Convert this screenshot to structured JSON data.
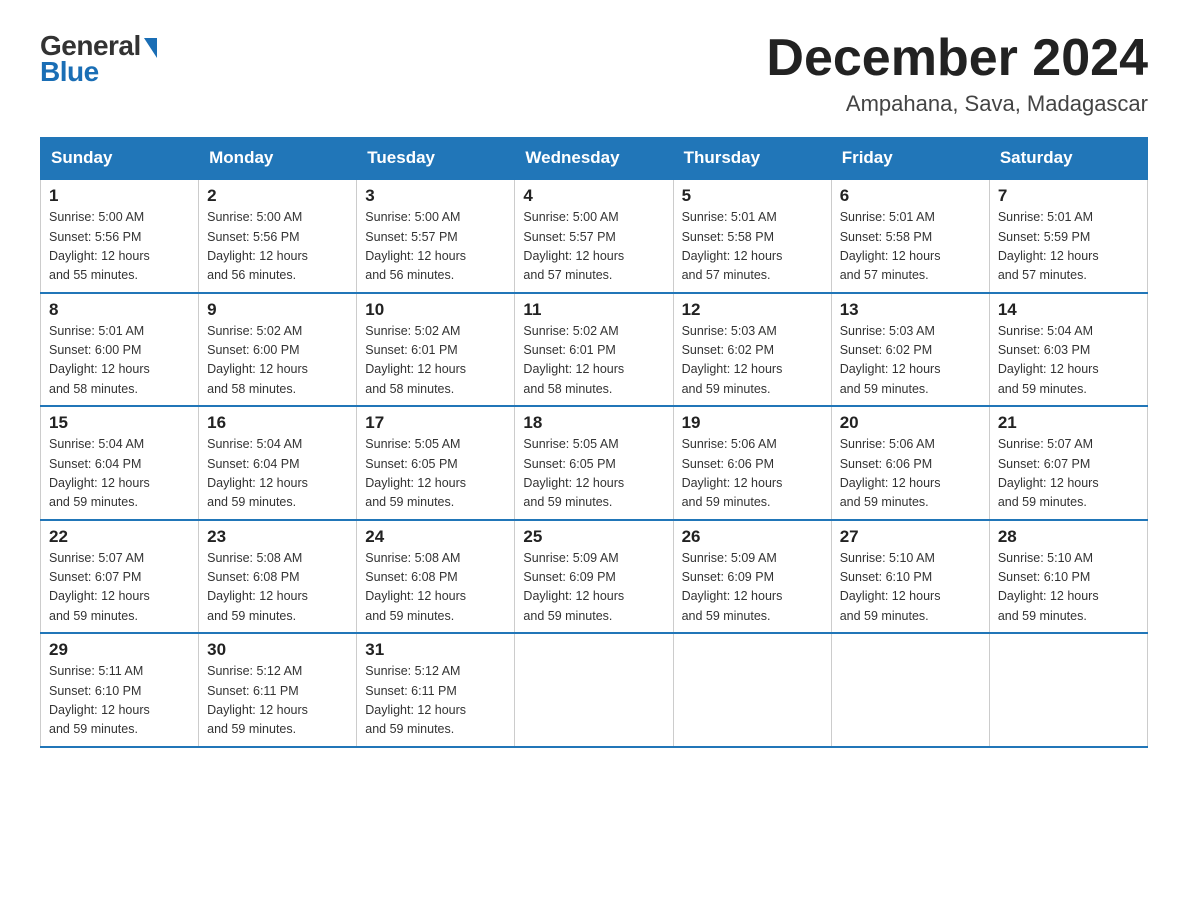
{
  "logo": {
    "general": "General",
    "blue": "Blue",
    "triangle": "▶"
  },
  "header": {
    "month_year": "December 2024",
    "location": "Ampahana, Sava, Madagascar"
  },
  "days_of_week": [
    "Sunday",
    "Monday",
    "Tuesday",
    "Wednesday",
    "Thursday",
    "Friday",
    "Saturday"
  ],
  "weeks": [
    [
      {
        "day": "1",
        "sunrise": "5:00 AM",
        "sunset": "5:56 PM",
        "daylight": "12 hours and 55 minutes."
      },
      {
        "day": "2",
        "sunrise": "5:00 AM",
        "sunset": "5:56 PM",
        "daylight": "12 hours and 56 minutes."
      },
      {
        "day": "3",
        "sunrise": "5:00 AM",
        "sunset": "5:57 PM",
        "daylight": "12 hours and 56 minutes."
      },
      {
        "day": "4",
        "sunrise": "5:00 AM",
        "sunset": "5:57 PM",
        "daylight": "12 hours and 57 minutes."
      },
      {
        "day": "5",
        "sunrise": "5:01 AM",
        "sunset": "5:58 PM",
        "daylight": "12 hours and 57 minutes."
      },
      {
        "day": "6",
        "sunrise": "5:01 AM",
        "sunset": "5:58 PM",
        "daylight": "12 hours and 57 minutes."
      },
      {
        "day": "7",
        "sunrise": "5:01 AM",
        "sunset": "5:59 PM",
        "daylight": "12 hours and 57 minutes."
      }
    ],
    [
      {
        "day": "8",
        "sunrise": "5:01 AM",
        "sunset": "6:00 PM",
        "daylight": "12 hours and 58 minutes."
      },
      {
        "day": "9",
        "sunrise": "5:02 AM",
        "sunset": "6:00 PM",
        "daylight": "12 hours and 58 minutes."
      },
      {
        "day": "10",
        "sunrise": "5:02 AM",
        "sunset": "6:01 PM",
        "daylight": "12 hours and 58 minutes."
      },
      {
        "day": "11",
        "sunrise": "5:02 AM",
        "sunset": "6:01 PM",
        "daylight": "12 hours and 58 minutes."
      },
      {
        "day": "12",
        "sunrise": "5:03 AM",
        "sunset": "6:02 PM",
        "daylight": "12 hours and 59 minutes."
      },
      {
        "day": "13",
        "sunrise": "5:03 AM",
        "sunset": "6:02 PM",
        "daylight": "12 hours and 59 minutes."
      },
      {
        "day": "14",
        "sunrise": "5:04 AM",
        "sunset": "6:03 PM",
        "daylight": "12 hours and 59 minutes."
      }
    ],
    [
      {
        "day": "15",
        "sunrise": "5:04 AM",
        "sunset": "6:04 PM",
        "daylight": "12 hours and 59 minutes."
      },
      {
        "day": "16",
        "sunrise": "5:04 AM",
        "sunset": "6:04 PM",
        "daylight": "12 hours and 59 minutes."
      },
      {
        "day": "17",
        "sunrise": "5:05 AM",
        "sunset": "6:05 PM",
        "daylight": "12 hours and 59 minutes."
      },
      {
        "day": "18",
        "sunrise": "5:05 AM",
        "sunset": "6:05 PM",
        "daylight": "12 hours and 59 minutes."
      },
      {
        "day": "19",
        "sunrise": "5:06 AM",
        "sunset": "6:06 PM",
        "daylight": "12 hours and 59 minutes."
      },
      {
        "day": "20",
        "sunrise": "5:06 AM",
        "sunset": "6:06 PM",
        "daylight": "12 hours and 59 minutes."
      },
      {
        "day": "21",
        "sunrise": "5:07 AM",
        "sunset": "6:07 PM",
        "daylight": "12 hours and 59 minutes."
      }
    ],
    [
      {
        "day": "22",
        "sunrise": "5:07 AM",
        "sunset": "6:07 PM",
        "daylight": "12 hours and 59 minutes."
      },
      {
        "day": "23",
        "sunrise": "5:08 AM",
        "sunset": "6:08 PM",
        "daylight": "12 hours and 59 minutes."
      },
      {
        "day": "24",
        "sunrise": "5:08 AM",
        "sunset": "6:08 PM",
        "daylight": "12 hours and 59 minutes."
      },
      {
        "day": "25",
        "sunrise": "5:09 AM",
        "sunset": "6:09 PM",
        "daylight": "12 hours and 59 minutes."
      },
      {
        "day": "26",
        "sunrise": "5:09 AM",
        "sunset": "6:09 PM",
        "daylight": "12 hours and 59 minutes."
      },
      {
        "day": "27",
        "sunrise": "5:10 AM",
        "sunset": "6:10 PM",
        "daylight": "12 hours and 59 minutes."
      },
      {
        "day": "28",
        "sunrise": "5:10 AM",
        "sunset": "6:10 PM",
        "daylight": "12 hours and 59 minutes."
      }
    ],
    [
      {
        "day": "29",
        "sunrise": "5:11 AM",
        "sunset": "6:10 PM",
        "daylight": "12 hours and 59 minutes."
      },
      {
        "day": "30",
        "sunrise": "5:12 AM",
        "sunset": "6:11 PM",
        "daylight": "12 hours and 59 minutes."
      },
      {
        "day": "31",
        "sunrise": "5:12 AM",
        "sunset": "6:11 PM",
        "daylight": "12 hours and 59 minutes."
      },
      null,
      null,
      null,
      null
    ]
  ],
  "cell_labels": {
    "sunrise_prefix": "Sunrise: ",
    "sunset_prefix": "Sunset: ",
    "daylight_prefix": "Daylight: "
  }
}
